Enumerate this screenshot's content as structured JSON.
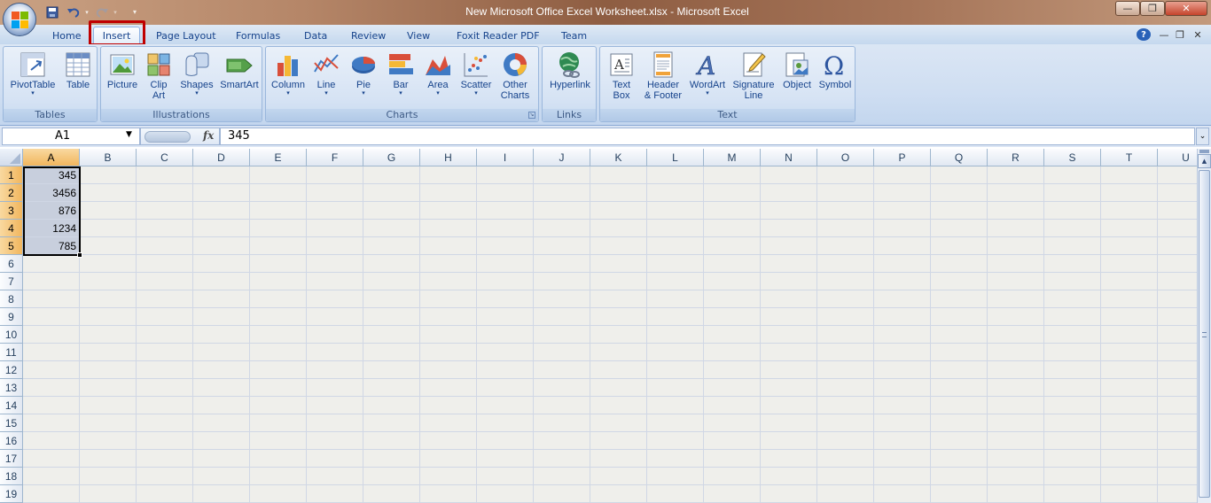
{
  "window": {
    "title": "New Microsoft Office Excel Worksheet.xlsx - Microsoft Excel"
  },
  "quick_access": {
    "save_icon": "save-icon",
    "undo_icon": "undo-icon",
    "redo_icon": "redo-icon",
    "customize_icon": "customize-qat-icon"
  },
  "window_controls": {
    "minimize": "—",
    "restore": "❐",
    "close": "✕"
  },
  "tabs": [
    {
      "label": "Home",
      "active": false
    },
    {
      "label": "Insert",
      "active": true
    },
    {
      "label": "Page Layout",
      "active": false
    },
    {
      "label": "Formulas",
      "active": false
    },
    {
      "label": "Data",
      "active": false
    },
    {
      "label": "Review",
      "active": false
    },
    {
      "label": "View",
      "active": false
    },
    {
      "label": "Foxit Reader PDF",
      "active": false
    },
    {
      "label": "Team",
      "active": false
    }
  ],
  "ribbon_controls": {
    "help": "?",
    "minimize": "—",
    "restore": "❐",
    "close": "✕"
  },
  "ribbon": {
    "groups": [
      {
        "label": "Tables",
        "buttons": [
          {
            "label": "PivotTable",
            "icon": "pivottable-icon"
          },
          {
            "label": "Table",
            "icon": "table-icon"
          }
        ]
      },
      {
        "label": "Illustrations",
        "buttons": [
          {
            "label": "Picture",
            "icon": "picture-icon"
          },
          {
            "label": "Clip\nArt",
            "icon": "clip-art-icon"
          },
          {
            "label": "Shapes",
            "icon": "shapes-icon"
          },
          {
            "label": "SmartArt",
            "icon": "smartart-icon"
          }
        ]
      },
      {
        "label": "Charts",
        "buttons": [
          {
            "label": "Column",
            "icon": "column-chart-icon"
          },
          {
            "label": "Line",
            "icon": "line-chart-icon"
          },
          {
            "label": "Pie",
            "icon": "pie-chart-icon"
          },
          {
            "label": "Bar",
            "icon": "bar-chart-icon"
          },
          {
            "label": "Area",
            "icon": "area-chart-icon"
          },
          {
            "label": "Scatter",
            "icon": "scatter-chart-icon"
          },
          {
            "label": "Other\nCharts",
            "icon": "other-charts-icon"
          }
        ]
      },
      {
        "label": "Links",
        "buttons": [
          {
            "label": "Hyperlink",
            "icon": "hyperlink-icon"
          }
        ]
      },
      {
        "label": "Text",
        "buttons": [
          {
            "label": "Text\nBox",
            "icon": "text-box-icon"
          },
          {
            "label": "Header\n& Footer",
            "icon": "header-footer-icon"
          },
          {
            "label": "WordArt",
            "icon": "wordart-icon"
          },
          {
            "label": "Signature\nLine",
            "icon": "signature-line-icon"
          },
          {
            "label": "Object",
            "icon": "object-icon"
          },
          {
            "label": "Symbol",
            "icon": "symbol-icon"
          }
        ]
      }
    ]
  },
  "formula_bar": {
    "name_box": "A1",
    "fx_label": "fx",
    "formula": "345"
  },
  "sheet": {
    "columns": [
      "A",
      "B",
      "C",
      "D",
      "E",
      "F",
      "G",
      "H",
      "I",
      "J",
      "K",
      "L",
      "M",
      "N",
      "O",
      "P",
      "Q",
      "R",
      "S",
      "T",
      "U"
    ],
    "rows": [
      "1",
      "2",
      "3",
      "4",
      "5",
      "6",
      "7",
      "8",
      "9",
      "10",
      "11",
      "12",
      "13",
      "14",
      "15",
      "16",
      "17",
      "18",
      "19"
    ],
    "cells": {
      "A1": "345",
      "A2": "3456",
      "A3": "876",
      "A4": "1234",
      "A5": "785"
    }
  },
  "colors": {
    "ribbon_text": "#15428b",
    "selected_header": "#f1b65e",
    "highlight_outline": "#c00000"
  }
}
